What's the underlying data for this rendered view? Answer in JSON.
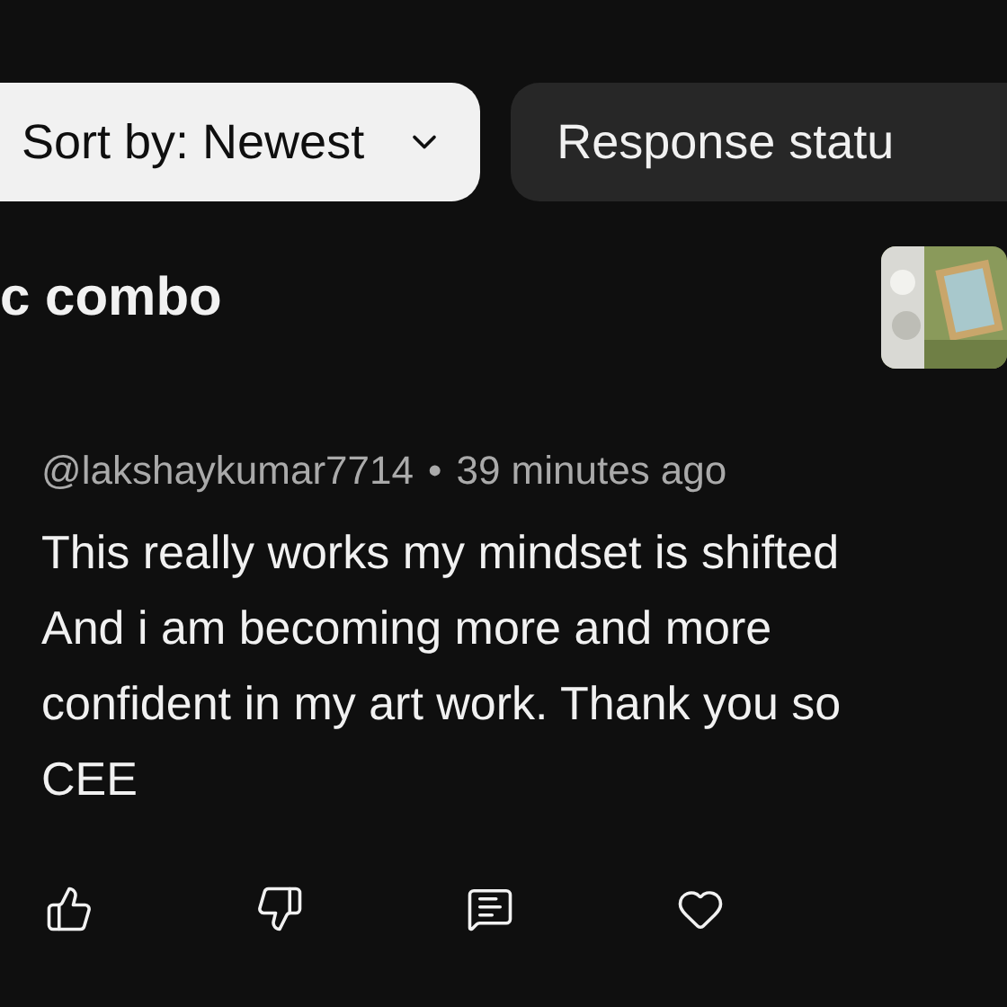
{
  "chips": [
    {
      "label": "Sort by: Newest",
      "selected": true,
      "kind": "dropdown"
    },
    {
      "label": "Response statu",
      "selected": false,
      "kind": "plain"
    }
  ],
  "video": {
    "title": "c combo"
  },
  "comment": {
    "author": "@lakshaykumar7714",
    "separator": "•",
    "time": "39 minutes ago",
    "lines": [
      "This really works my mindset is shifted",
      "And i am becoming more and more",
      "confident in my art work. Thank you so",
      "CEE"
    ]
  },
  "actions": [
    {
      "kind": "like"
    },
    {
      "kind": "dislike"
    },
    {
      "kind": "reply"
    },
    {
      "kind": "heart"
    }
  ]
}
